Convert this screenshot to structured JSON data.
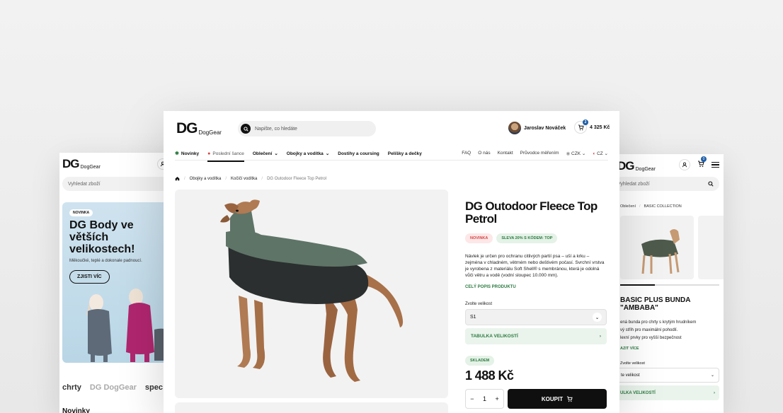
{
  "left": {
    "search_placeholder": "Vyhledat zboží",
    "cart_count": "0",
    "banner": {
      "tag": "NOVINKA",
      "title": "DG Body ve větších velikostech!",
      "subtitle": "Měkoučké, teplé a dokonale padnoucí.",
      "button": "ZJISTI VÍC"
    },
    "brands": [
      "chrty",
      "DG DogGear",
      "spec"
    ],
    "section_title": "Novinky"
  },
  "main": {
    "logo": {
      "mark": "DG",
      "name": "DogGear"
    },
    "search_placeholder": "Napište, co hledáte",
    "user_name": "Jaroslav Nováček",
    "cart_count": "2",
    "cart_total": "4 325 Kč",
    "nav": [
      {
        "label": "Novinky"
      },
      {
        "label": "Poslední šance"
      },
      {
        "label": "Oblečení"
      },
      {
        "label": "Obojky a vodítka"
      },
      {
        "label": "Dostihy a coursing"
      },
      {
        "label": "Pelíšky a dečky"
      }
    ],
    "nav_right": {
      "faq": "FAQ",
      "about": "O nás",
      "contact": "Kontakt",
      "guide": "Průvodce měřením",
      "currency": "CZK",
      "language": "CZ"
    },
    "breadcrumb": [
      "Obojky a vodítka",
      "Kočičí vodítka",
      "DG Outodoor Fleece Top Petrol"
    ],
    "product": {
      "title": "DG Outodoor Fleece Top Petrol",
      "tag_new": "NOVINKA",
      "tag_sale": "SLEVA 20% S KÓDEM: TOP",
      "description": "Návlek je určen pro ochranu citlivých partií psa – uší a krku – zejména v chladném, větrném nebo deštivém počasí. Svrchní vrstva je vyrobena z materiálu Soft Shell® s membránou, která je odolná vůči větru a vodě (vodní sloupec 10.000 mm).",
      "full_description_link": "CELÝ POPIS PRODUKTU",
      "size_label": "Zvolte velikost",
      "size_value": "S1",
      "size_table": "TABULKA VELIKOSTÍ",
      "stock": "SKLADEM",
      "price": "1 488 Kč",
      "quantity": "1",
      "buy": "KOUPIT"
    }
  },
  "right": {
    "search_placeholder": "Vyhledat zboží",
    "cart_count": "0",
    "breadcrumb": [
      "Oblečení",
      "BASIC COLLECTION"
    ],
    "title": "BASIC PLUS BUNDA \"AMBABA\"",
    "subtitle_lines": [
      "ená bunda pro chrty s krytým hrudníkem",
      "vý střih pro maximální pohodlí.",
      "lexní prvky pro vyšší bezpečnost"
    ],
    "more": "AZIT VÍCE",
    "size_label": "Zvolte velikost",
    "size_value": "te velikost",
    "size_table": "ULKA VELIKOSTÍ",
    "progress": 0.35
  },
  "colors": {
    "accent_green": "#2b7a40",
    "sale_red": "#d64545",
    "badge_blue": "#1e5ea8",
    "buy_black": "#0f0f0f"
  }
}
